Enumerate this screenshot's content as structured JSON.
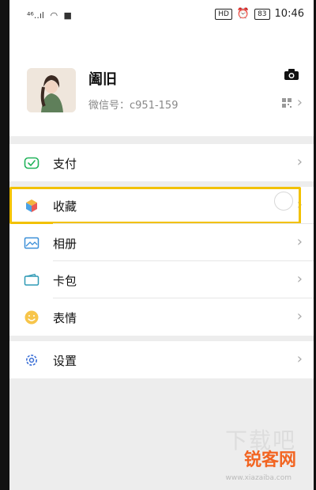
{
  "status_bar": {
    "signal": "⁴⁶..ıl",
    "wifi": "wifi-icon",
    "hd": "HD",
    "battery": "83",
    "time": "10:46"
  },
  "profile": {
    "name": "阖旧",
    "wechat_id": "微信号：c951-159"
  },
  "menu": [
    {
      "label": "支付",
      "icon": "wechat-pay-icon"
    },
    {
      "label": "收藏",
      "icon": "favorites-cube-icon"
    },
    {
      "label": "相册",
      "icon": "album-icon"
    },
    {
      "label": "卡包",
      "icon": "card-wallet-icon"
    },
    {
      "label": "表情",
      "icon": "emoji-smile-icon"
    },
    {
      "label": "设置",
      "icon": "settings-gear-icon"
    }
  ],
  "watermark": {
    "brand": "锐客网",
    "big": "下载吧",
    "domain": "www.xiazaiba.com"
  },
  "colors": {
    "highlight": "#f2c100",
    "pay_green": "#21b35a",
    "settings_blue": "#3b6fd6",
    "emoji_yellow": "#f7c54a"
  }
}
